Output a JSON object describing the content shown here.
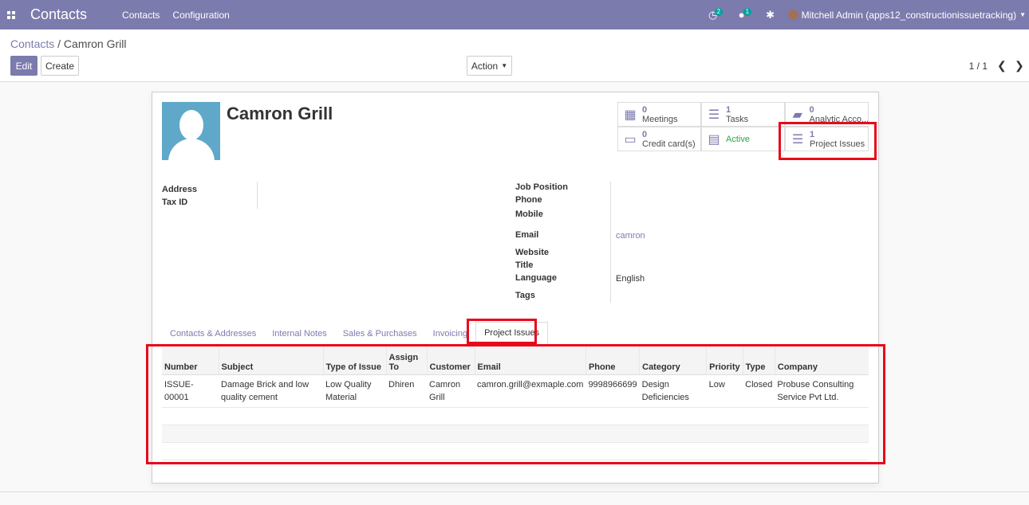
{
  "topbar": {
    "brand": "Contacts",
    "menu": [
      "Contacts",
      "Configuration"
    ],
    "activity_count": "2",
    "messages_count": "1",
    "user": "Mitchell Admin (apps12_constructionissuetracking)"
  },
  "breadcrumb": {
    "parent": "Contacts",
    "sep": "/",
    "current": "Camron Grill"
  },
  "buttons": {
    "edit": "Edit",
    "create": "Create",
    "action": "Action"
  },
  "pager": "1 / 1",
  "contact": {
    "name": "Camron Grill"
  },
  "smart_buttons": [
    {
      "count": "0",
      "label": "Meetings",
      "icon": "calendar-icon"
    },
    {
      "count": "1",
      "label": "Tasks",
      "icon": "tasks-icon"
    },
    {
      "count": "0",
      "label": "Analytic Acco...",
      "icon": "book-icon"
    },
    {
      "count": "0",
      "label": "Credit card(s)",
      "icon": "credit-card-icon"
    },
    {
      "count": "",
      "label": "Active",
      "icon": "archive-icon"
    },
    {
      "count": "1",
      "label": "Project Issues",
      "icon": "issues-icon"
    }
  ],
  "fields_left": {
    "address": "Address",
    "tax_id": "Tax ID"
  },
  "fields_right": {
    "job_position": "Job Position",
    "phone": "Phone",
    "mobile": "Mobile",
    "email": "Email",
    "email_value": "camron",
    "website": "Website",
    "title": "Title",
    "language": "Language",
    "language_value": "English",
    "tags": "Tags"
  },
  "tabs": [
    "Contacts & Addresses",
    "Internal Notes",
    "Sales & Purchases",
    "Invoicing",
    "Project Issues"
  ],
  "table": {
    "headers": [
      "Number",
      "Subject",
      "Type of Issue",
      "Assign To",
      "Customer",
      "Email",
      "Phone",
      "Category",
      "Priority",
      "Type",
      "Company"
    ],
    "rows": [
      [
        "ISSUE-00001",
        "Damage Brick and low quality cement",
        "Low Quality Material",
        "Dhiren",
        "Camron Grill",
        "camron.grill@exmaple.com",
        "9998966699",
        "Design Deficiencies",
        "Low",
        "Closed",
        "Probuse Consulting Service Pvt Ltd."
      ]
    ]
  },
  "colors": {
    "brand": "#7c7bad",
    "highlight": "#e8081a",
    "active": "#28a745"
  }
}
